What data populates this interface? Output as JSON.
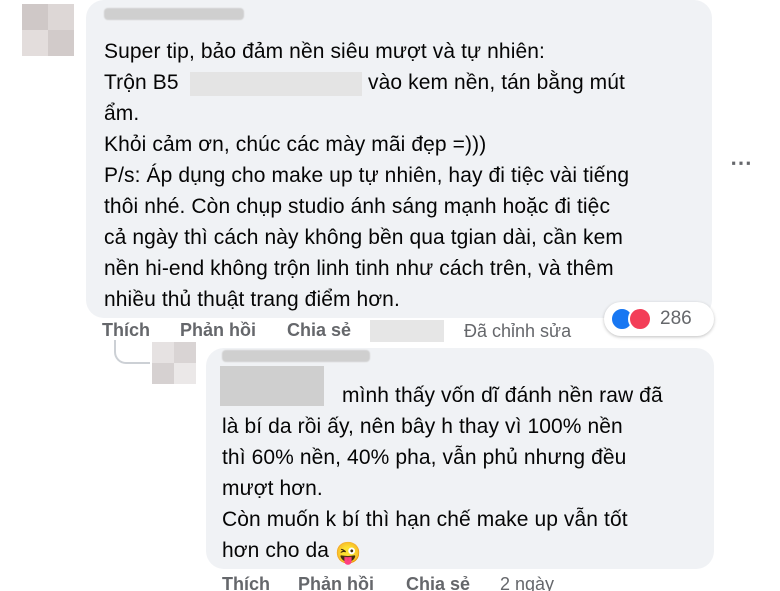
{
  "main_comment": {
    "lines": [
      "Super tip, bảo đảm nền siêu mượt và tự nhiên:",
      "Trộn B5",
      "vào kem nền, tán bằng mút",
      "ẩm.",
      "Khỏi cảm ơn, chúc các mày mãi đẹp =)))",
      "P/s: Áp dụng cho make up tự nhiên, hay đi tiệc vài tiếng",
      "thôi nhé. Còn chụp studio ánh sáng mạnh hoặc đi tiệc",
      "cả ngày thì cách này không bền qua tgian dài, cần kem",
      "nền hi-end không trộn linh tinh như cách trên, và thêm",
      "nhiều thủ thuật trang điểm hơn."
    ],
    "actions": {
      "like": "Thích",
      "reply": "Phản hồi",
      "share": "Chia sẻ",
      "edited": "Đã chỉnh sửa"
    },
    "reactions": {
      "count": "286",
      "like_color": "#1877f2",
      "love_color": "#f33e58"
    },
    "more_icon": "⋯"
  },
  "reply_comment": {
    "lines": [
      "mình thấy vốn dĩ đánh nền raw đã",
      "là bí da rồi ấy, nên bây h thay vì 100% nền",
      "thì 60% nền, 40% pha, vẫn phủ nhưng đều",
      "mượt hơn.",
      "Còn muốn k bí thì hạn chế make up vẫn tốt",
      "hơn cho da"
    ],
    "emoji": "😜",
    "actions": {
      "like": "Thích",
      "reply": "Phản hồi",
      "share": "Chia sẻ",
      "time": "2 ngày"
    }
  },
  "colors": {
    "bubble": "#f0f2f5",
    "meta": "#65676b"
  }
}
